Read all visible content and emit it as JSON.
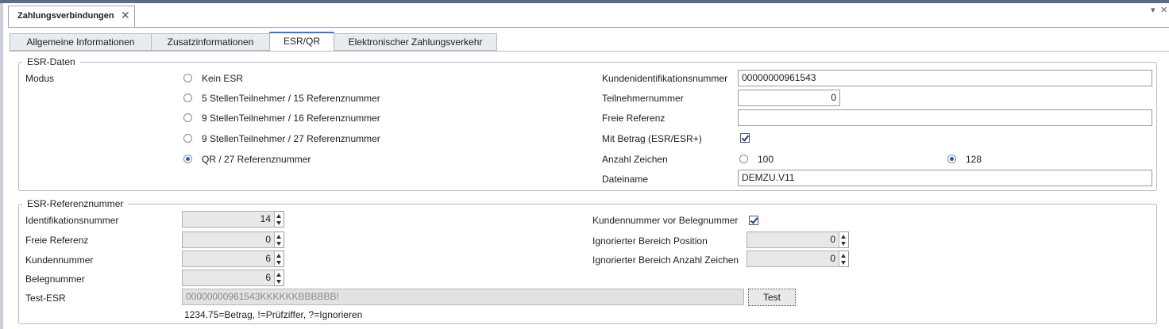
{
  "document_tab": {
    "title": "Zahlungsverbindungen",
    "close_icon": "close-icon"
  },
  "tabs": [
    "Allgemeine Informationen",
    "Zusatzinformationen",
    "ESR/QR",
    "Elektronischer Zahlungsverkehr"
  ],
  "active_tab": "ESR/QR",
  "esr_daten": {
    "legend": "ESR-Daten",
    "modus_label": "Modus",
    "modes": [
      "Kein ESR",
      "5 StellenTeilnehmer / 15 Referenznummer",
      "9 StellenTeilnehmer / 16 Referenznummer",
      "9 StellenTeilnehmer / 27 Referenznummer",
      "QR / 27 Referenznummer"
    ],
    "selected_mode": "QR / 27 Referenznummer",
    "kundenid_label": "Kundenidentifikationsnummer",
    "kundenid_value": "00000000961543",
    "teilnehmer_label": "Teilnehmernummer",
    "teilnehmer_value": "0",
    "freie_ref_label": "Freie Referenz",
    "freie_ref_value": "",
    "mit_betrag_label": "Mit Betrag (ESR/ESR+)",
    "mit_betrag_checked": true,
    "anzahl_label": "Anzahl Zeichen",
    "anzahl_options": [
      "100",
      "128"
    ],
    "anzahl_selected": "128",
    "dateiname_label": "Dateiname",
    "dateiname_value": "DEMZU.V11"
  },
  "esr_ref": {
    "legend": "ESR-Referenznummer",
    "ident_label": "Identifikationsnummer",
    "ident_value": "14",
    "freie_ref_label": "Freie Referenz",
    "freie_ref_value": "0",
    "kundennummer_label": "Kundennummer",
    "kundennummer_value": "6",
    "belegnummer_label": "Belegnummer",
    "belegnummer_value": "6",
    "test_esr_label": "Test-ESR",
    "test_esr_value": "00000000961543KKKKKKBBBBBB!",
    "test_button": "Test",
    "hint": "1234.75=Betrag, !=Prüfziffer, ?=Ignorieren",
    "kunde_vor_beleg_label": "Kundennummer vor Belegnummer",
    "kunde_vor_beleg_checked": true,
    "ign_pos_label": "Ignorierter Bereich Position",
    "ign_pos_value": "0",
    "ign_anz_label": "Ignorierter Bereich Anzahl Zeichen",
    "ign_anz_value": "0"
  }
}
